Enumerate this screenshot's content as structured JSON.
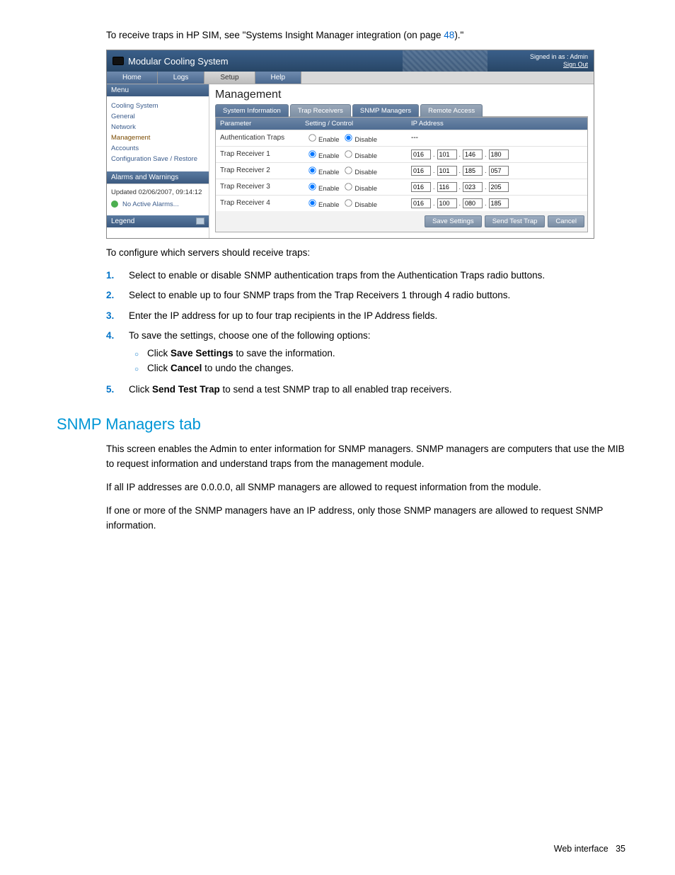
{
  "intro_text_pre": "To receive traps in HP SIM, see \"Systems Insight Manager integration (on page ",
  "intro_link": "48",
  "intro_text_post": ").\"",
  "app": {
    "title": "Modular Cooling System",
    "signed_in": "Signed in as : Admin",
    "sign_out": "Sign Out",
    "nav": {
      "home": "Home",
      "logs": "Logs",
      "setup": "Setup",
      "help": "Help"
    },
    "menu_header": "Menu",
    "menu": {
      "cooling": "Cooling System",
      "general": "General",
      "network": "Network",
      "management": "Management",
      "accounts": "Accounts",
      "config": "Configuration Save / Restore"
    },
    "mgmt_title": "Management",
    "tabs": {
      "sysinfo": "System Information",
      "trap": "Trap Receivers",
      "snmp": "SNMP Managers",
      "remote": "Remote Access"
    },
    "cols": {
      "param": "Parameter",
      "setting": "Setting / Control",
      "ip": "IP Address"
    },
    "enable": "Enable",
    "disable": "Disable",
    "rows": {
      "auth": "Authentication Traps",
      "r1": "Trap Receiver 1",
      "r2": "Trap Receiver 2",
      "r3": "Trap Receiver 3",
      "r4": "Trap Receiver 4"
    },
    "ips": {
      "r1": [
        "016",
        "101",
        "146",
        "180"
      ],
      "r2": [
        "016",
        "101",
        "185",
        "057"
      ],
      "r3": [
        "016",
        "116",
        "023",
        "205"
      ],
      "r4": [
        "016",
        "100",
        "080",
        "185"
      ]
    },
    "ip_placeholder": "---",
    "buttons": {
      "save": "Save Settings",
      "test": "Send Test Trap",
      "cancel": "Cancel"
    },
    "alarms_header": "Alarms and Warnings",
    "updated": "Updated 02/06/2007, 09:14:12",
    "no_alarms": "No Active Alarms...",
    "legend": "Legend"
  },
  "config_intro": "To configure which servers should receive traps:",
  "steps": {
    "s1": "Select to enable or disable SNMP authentication traps from the Authentication Traps radio buttons.",
    "s2": "Select to enable up to four SNMP traps from the Trap Receivers 1 through 4 radio buttons.",
    "s3": "Enter the IP address for up to four trap recipients in the IP Address fields.",
    "s4": "To save the settings, choose one of the following options:",
    "s4a_pre": "Click ",
    "s4a_bold": "Save Settings",
    "s4a_post": " to save the information.",
    "s4b_pre": "Click ",
    "s4b_bold": "Cancel",
    "s4b_post": " to undo the changes.",
    "s5_pre": "Click ",
    "s5_bold": "Send Test Trap",
    "s5_post": " to send a test SNMP trap to all enabled trap receivers."
  },
  "section_heading": "SNMP Managers tab",
  "para1": "This screen enables the Admin to enter information for SNMP managers. SNMP managers are computers that use the MIB to request information and understand traps from the management module.",
  "para2": "If all IP addresses are 0.0.0.0, all SNMP managers are allowed to request information from the module.",
  "para3": "If one or more of the SNMP managers have an IP address, only those SNMP managers are allowed to request SNMP information.",
  "footer_label": "Web interface",
  "footer_page": "35"
}
